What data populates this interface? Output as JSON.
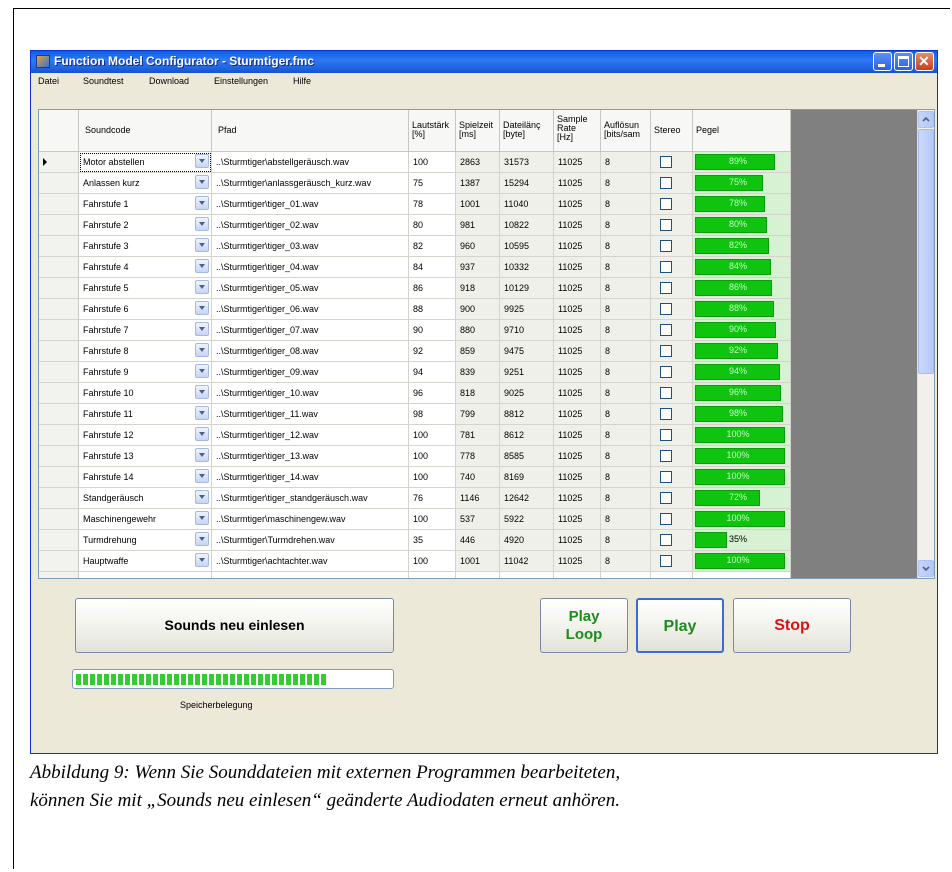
{
  "window": {
    "title": "Function Model Configurator - Sturmtiger.fmc",
    "menu": [
      "Datei",
      "Soundtest",
      "Download",
      "Einstellungen",
      "Hilfe"
    ]
  },
  "grid": {
    "columns": [
      {
        "key": "soundcode",
        "label": "Soundcode"
      },
      {
        "key": "pfad",
        "label": "Pfad"
      },
      {
        "key": "lautstaerke",
        "label": "Lautstärk\n[%]"
      },
      {
        "key": "spielzeit",
        "label": "Spielzeit\n[ms]"
      },
      {
        "key": "dateilaenge",
        "label": "Dateilänç\n[byte]"
      },
      {
        "key": "samplerate",
        "label": "Sample\nRate\n[Hz]"
      },
      {
        "key": "aufloesung",
        "label": "Auflösun\n[bits/sam"
      },
      {
        "key": "stereo",
        "label": "Stereo"
      },
      {
        "key": "pegel",
        "label": "Pegel"
      }
    ],
    "rows": [
      {
        "soundcode": "Motor abstellen",
        "pfad": "..\\Sturmtiger\\abstellgeräusch.wav",
        "lautstaerke": "100",
        "spielzeit": "2863",
        "dateilaenge": "31573",
        "samplerate": "11025",
        "aufloesung": "8",
        "pegel": 89,
        "pegel_label": "89%"
      },
      {
        "soundcode": "Anlassen kurz",
        "pfad": "..\\Sturmtiger\\anlassgeräusch_kurz.wav",
        "lautstaerke": "75",
        "spielzeit": "1387",
        "dateilaenge": "15294",
        "samplerate": "11025",
        "aufloesung": "8",
        "pegel": 75,
        "pegel_label": "75%"
      },
      {
        "soundcode": "Fahrstufe 1",
        "pfad": "..\\Sturmtiger\\tiger_01.wav",
        "lautstaerke": "78",
        "spielzeit": "1001",
        "dateilaenge": "11040",
        "samplerate": "11025",
        "aufloesung": "8",
        "pegel": 78,
        "pegel_label": "78%"
      },
      {
        "soundcode": "Fahrstufe 2",
        "pfad": "..\\Sturmtiger\\tiger_02.wav",
        "lautstaerke": "80",
        "spielzeit": "981",
        "dateilaenge": "10822",
        "samplerate": "11025",
        "aufloesung": "8",
        "pegel": 80,
        "pegel_label": "80%"
      },
      {
        "soundcode": "Fahrstufe 3",
        "pfad": "..\\Sturmtiger\\tiger_03.wav",
        "lautstaerke": "82",
        "spielzeit": "960",
        "dateilaenge": "10595",
        "samplerate": "11025",
        "aufloesung": "8",
        "pegel": 82,
        "pegel_label": "82%"
      },
      {
        "soundcode": "Fahrstufe 4",
        "pfad": "..\\Sturmtiger\\tiger_04.wav",
        "lautstaerke": "84",
        "spielzeit": "937",
        "dateilaenge": "10332",
        "samplerate": "11025",
        "aufloesung": "8",
        "pegel": 84,
        "pegel_label": "84%"
      },
      {
        "soundcode": "Fahrstufe 5",
        "pfad": "..\\Sturmtiger\\tiger_05.wav",
        "lautstaerke": "86",
        "spielzeit": "918",
        "dateilaenge": "10129",
        "samplerate": "11025",
        "aufloesung": "8",
        "pegel": 86,
        "pegel_label": "86%"
      },
      {
        "soundcode": "Fahrstufe 6",
        "pfad": "..\\Sturmtiger\\tiger_06.wav",
        "lautstaerke": "88",
        "spielzeit": "900",
        "dateilaenge": "9925",
        "samplerate": "11025",
        "aufloesung": "8",
        "pegel": 88,
        "pegel_label": "88%"
      },
      {
        "soundcode": "Fahrstufe 7",
        "pfad": "..\\Sturmtiger\\tiger_07.wav",
        "lautstaerke": "90",
        "spielzeit": "880",
        "dateilaenge": "9710",
        "samplerate": "11025",
        "aufloesung": "8",
        "pegel": 90,
        "pegel_label": "90%"
      },
      {
        "soundcode": "Fahrstufe 8",
        "pfad": "..\\Sturmtiger\\tiger_08.wav",
        "lautstaerke": "92",
        "spielzeit": "859",
        "dateilaenge": "9475",
        "samplerate": "11025",
        "aufloesung": "8",
        "pegel": 92,
        "pegel_label": "92%"
      },
      {
        "soundcode": "Fahrstufe 9",
        "pfad": "..\\Sturmtiger\\tiger_09.wav",
        "lautstaerke": "94",
        "spielzeit": "839",
        "dateilaenge": "9251",
        "samplerate": "11025",
        "aufloesung": "8",
        "pegel": 94,
        "pegel_label": "94%"
      },
      {
        "soundcode": "Fahrstufe 10",
        "pfad": "..\\Sturmtiger\\tiger_10.wav",
        "lautstaerke": "96",
        "spielzeit": "818",
        "dateilaenge": "9025",
        "samplerate": "11025",
        "aufloesung": "8",
        "pegel": 96,
        "pegel_label": "96%"
      },
      {
        "soundcode": "Fahrstufe 11",
        "pfad": "..\\Sturmtiger\\tiger_11.wav",
        "lautstaerke": "98",
        "spielzeit": "799",
        "dateilaenge": "8812",
        "samplerate": "11025",
        "aufloesung": "8",
        "pegel": 98,
        "pegel_label": "98%"
      },
      {
        "soundcode": "Fahrstufe 12",
        "pfad": "..\\Sturmtiger\\tiger_12.wav",
        "lautstaerke": "100",
        "spielzeit": "781",
        "dateilaenge": "8612",
        "samplerate": "11025",
        "aufloesung": "8",
        "pegel": 100,
        "pegel_label": "100%"
      },
      {
        "soundcode": "Fahrstufe 13",
        "pfad": "..\\Sturmtiger\\tiger_13.wav",
        "lautstaerke": "100",
        "spielzeit": "778",
        "dateilaenge": "8585",
        "samplerate": "11025",
        "aufloesung": "8",
        "pegel": 100,
        "pegel_label": "100%"
      },
      {
        "soundcode": "Fahrstufe 14",
        "pfad": "..\\Sturmtiger\\tiger_14.wav",
        "lautstaerke": "100",
        "spielzeit": "740",
        "dateilaenge": "8169",
        "samplerate": "11025",
        "aufloesung": "8",
        "pegel": 100,
        "pegel_label": "100%"
      },
      {
        "soundcode": "Standgeräusch",
        "pfad": "..\\Sturmtiger\\tiger_standgeräusch.wav",
        "lautstaerke": "76",
        "spielzeit": "1146",
        "dateilaenge": "12642",
        "samplerate": "11025",
        "aufloesung": "8",
        "pegel": 72,
        "pegel_label": "72%"
      },
      {
        "soundcode": "Maschinengewehr",
        "pfad": "..\\Sturmtiger\\maschinengew.wav",
        "lautstaerke": "100",
        "spielzeit": "537",
        "dateilaenge": "5922",
        "samplerate": "11025",
        "aufloesung": "8",
        "pegel": 100,
        "pegel_label": "100%"
      },
      {
        "soundcode": "Turmdrehung",
        "pfad": "..\\Sturmtiger\\Turmdrehen.wav",
        "lautstaerke": "35",
        "spielzeit": "446",
        "dateilaenge": "4920",
        "samplerate": "11025",
        "aufloesung": "8",
        "pegel": 35,
        "pegel_label": "35%"
      },
      {
        "soundcode": "Hauptwaffe",
        "pfad": "..\\Sturmtiger\\achtachter.wav",
        "lautstaerke": "100",
        "spielzeit": "1001",
        "dateilaenge": "11042",
        "samplerate": "11025",
        "aufloesung": "8",
        "pegel": 100,
        "pegel_label": "100%"
      }
    ]
  },
  "buttons": {
    "reload": "Sounds neu einlesen",
    "play_loop_line1": "Play",
    "play_loop_line2": "Loop",
    "play": "Play",
    "stop": "Stop"
  },
  "memory": {
    "label": "Speicherbelegung",
    "fill": 0.82
  },
  "caption": {
    "line1": "Abbildung 9: Wenn Sie Sounddateien mit externen Programmen bearbeiteten,",
    "line2": "können Sie mit „Sounds neu einlesen“ geänderte Audiodaten erneut anhören."
  },
  "colors": {
    "play_loop": "#1f8a1f",
    "play": "#1f8a1f",
    "stop": "#dd1111",
    "level_bar": "#0ec40e"
  }
}
